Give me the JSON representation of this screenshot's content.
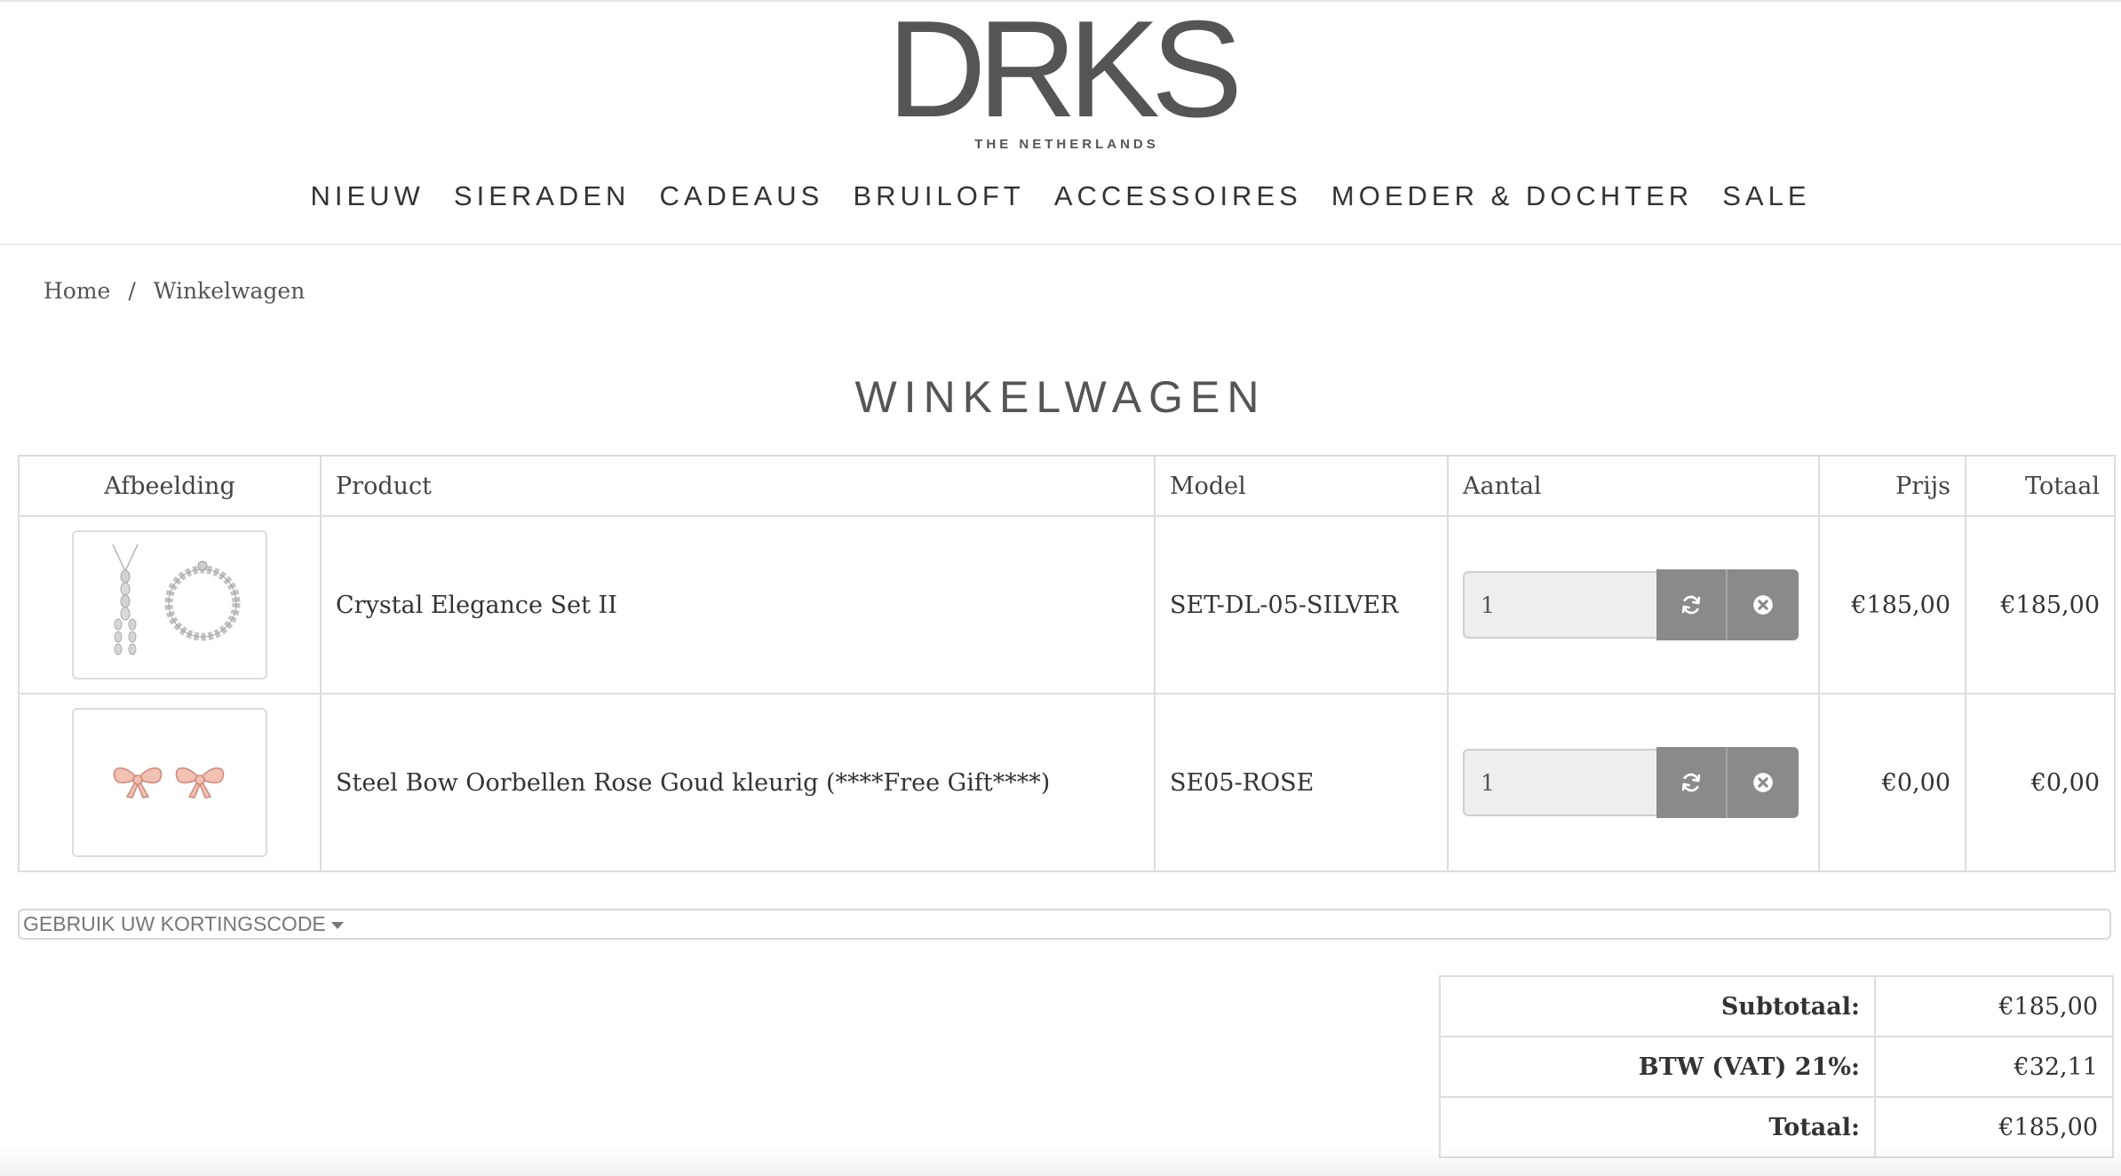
{
  "header": {
    "logo_main": "DRKS",
    "logo_sub": "THE NETHERLANDS"
  },
  "nav": {
    "items": [
      {
        "label": "NIEUW"
      },
      {
        "label": "SIERADEN"
      },
      {
        "label": "CADEAUS"
      },
      {
        "label": "BRUILOFT"
      },
      {
        "label": "ACCESSOIRES"
      },
      {
        "label": "MOEDER & DOCHTER"
      },
      {
        "label": "SALE"
      }
    ]
  },
  "breadcrumb": {
    "home": "Home",
    "separator": "/",
    "current": "Winkelwagen"
  },
  "page_title": "WINKELWAGEN",
  "cart": {
    "columns": {
      "image": "Afbeelding",
      "product": "Product",
      "model": "Model",
      "quantity": "Aantal",
      "price": "Prijs",
      "total": "Totaal"
    },
    "rows": [
      {
        "product": "Crystal Elegance Set II",
        "model": "SET-DL-05-SILVER",
        "quantity": "1",
        "price": "€185,00",
        "total": "€185,00",
        "image_icon": "crystal-jewelry-set-image"
      },
      {
        "product": "Steel Bow Oorbellen Rose Goud kleurig (****Free Gift****)",
        "model": "SE05-ROSE",
        "quantity": "1",
        "price": "€0,00",
        "total": "€0,00",
        "image_icon": "bow-earrings-image"
      }
    ],
    "update_icon": "refresh-icon",
    "remove_icon": "remove-icon"
  },
  "coupon": {
    "label": "GEBRUIK UW KORTINGSCODE"
  },
  "totals": {
    "subtotal_label": "Subtotaal:",
    "subtotal_value": "€185,00",
    "vat_label": "BTW (VAT) 21%:",
    "vat_value": "€32,11",
    "total_label": "Totaal:",
    "total_value": "€185,00"
  },
  "colors": {
    "button_gray": "#8a8a8a",
    "border": "#dddddd",
    "text": "#333333",
    "rose_gold": "#e7a597"
  }
}
